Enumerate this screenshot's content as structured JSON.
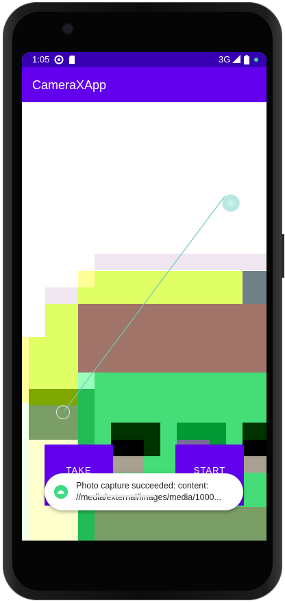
{
  "status_bar": {
    "time": "1:05",
    "network": "3G",
    "icons": [
      "assistant-icon",
      "sd-card-icon",
      "signal-icon",
      "battery-icon",
      "notification-dot-icon"
    ]
  },
  "app_bar": {
    "title": "CameraXApp"
  },
  "buttons": {
    "take_label": "TAKE",
    "start_label": "START"
  },
  "toast": {
    "line1": "Photo capture succeeded: content:",
    "line2": "//media/external/images/media/1000...",
    "icon": "android-icon"
  },
  "colors": {
    "status_bar": "#3700b3",
    "app_bar": "#6200ee",
    "button": "#6200ee",
    "toast_icon": "#3ddc84"
  }
}
